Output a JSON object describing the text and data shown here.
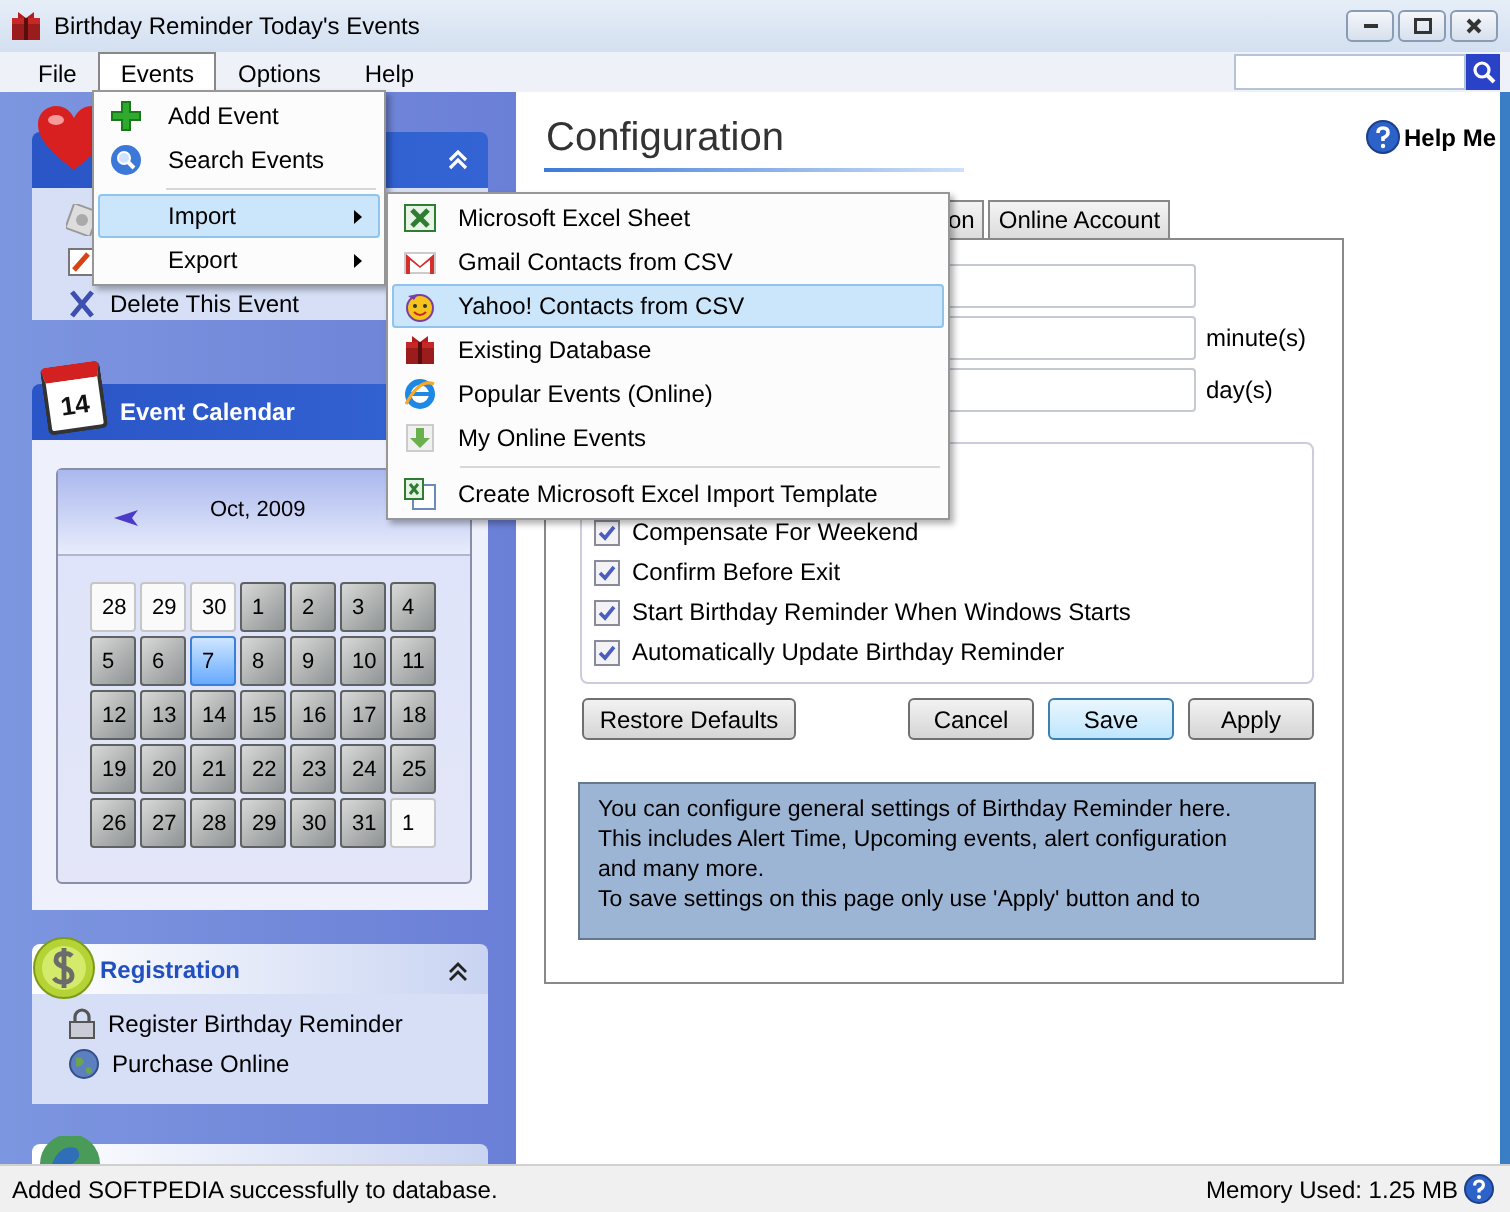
{
  "window": {
    "title": "Birthday Reminder Today's Events"
  },
  "menu_bar": [
    {
      "label": "File",
      "selected": false
    },
    {
      "label": "Events",
      "selected": true
    },
    {
      "label": "Options",
      "selected": false
    },
    {
      "label": "Help",
      "selected": false
    }
  ],
  "events_menu": [
    {
      "kind": "item",
      "label": "Add Event",
      "selected": false
    },
    {
      "kind": "item",
      "label": "Search Events",
      "selected": false
    },
    {
      "kind": "separator"
    },
    {
      "kind": "submenu",
      "label": "Import",
      "selected": true
    },
    {
      "kind": "submenu",
      "label": "Export",
      "selected": false
    }
  ],
  "import_submenu": [
    {
      "kind": "item",
      "label": "Microsoft Excel Sheet",
      "selected": false
    },
    {
      "kind": "item",
      "label": "Gmail Contacts from CSV",
      "selected": false
    },
    {
      "kind": "item",
      "label": "Yahoo! Contacts from CSV",
      "selected": true
    },
    {
      "kind": "item",
      "label": "Existing Database",
      "selected": false
    },
    {
      "kind": "item",
      "label": "Popular Events (Online)",
      "selected": false
    },
    {
      "kind": "item",
      "label": "My Online Events",
      "selected": false
    },
    {
      "kind": "separator"
    },
    {
      "kind": "item",
      "label": "Create Microsoft Excel Import Template",
      "selected": false
    }
  ],
  "event_panel": {
    "items": [
      {
        "label": "Delete This Event"
      }
    ]
  },
  "calendar_panel": {
    "title": "Event Calendar",
    "icon_day": "14",
    "month": "Oct, 2009",
    "days": [
      {
        "day": "28",
        "kind": "other",
        "selected": false
      },
      {
        "day": "29",
        "kind": "other",
        "selected": false
      },
      {
        "day": "30",
        "kind": "other",
        "selected": false
      },
      {
        "day": "1",
        "kind": "current",
        "selected": false
      },
      {
        "day": "2",
        "kind": "current",
        "selected": false
      },
      {
        "day": "3",
        "kind": "current",
        "selected": false
      },
      {
        "day": "4",
        "kind": "current",
        "selected": false
      },
      {
        "day": "5",
        "kind": "current",
        "selected": false
      },
      {
        "day": "6",
        "kind": "current",
        "selected": false
      },
      {
        "day": "7",
        "kind": "current",
        "selected": true
      },
      {
        "day": "8",
        "kind": "current",
        "selected": false
      },
      {
        "day": "9",
        "kind": "current",
        "selected": false
      },
      {
        "day": "10",
        "kind": "current",
        "selected": false
      },
      {
        "day": "11",
        "kind": "current",
        "selected": false
      },
      {
        "day": "12",
        "kind": "current",
        "selected": false
      },
      {
        "day": "13",
        "kind": "current",
        "selected": false
      },
      {
        "day": "14",
        "kind": "current",
        "selected": false
      },
      {
        "day": "15",
        "kind": "current",
        "selected": false
      },
      {
        "day": "16",
        "kind": "current",
        "selected": false
      },
      {
        "day": "17",
        "kind": "current",
        "selected": false
      },
      {
        "day": "18",
        "kind": "current",
        "selected": false
      },
      {
        "day": "19",
        "kind": "current",
        "selected": false
      },
      {
        "day": "20",
        "kind": "current",
        "selected": false
      },
      {
        "day": "21",
        "kind": "current",
        "selected": false
      },
      {
        "day": "22",
        "kind": "current",
        "selected": false
      },
      {
        "day": "23",
        "kind": "current",
        "selected": false
      },
      {
        "day": "24",
        "kind": "current",
        "selected": false
      },
      {
        "day": "25",
        "kind": "current",
        "selected": false
      },
      {
        "day": "26",
        "kind": "current",
        "selected": false
      },
      {
        "day": "27",
        "kind": "current",
        "selected": false
      },
      {
        "day": "28",
        "kind": "current",
        "selected": false
      },
      {
        "day": "29",
        "kind": "current",
        "selected": false
      },
      {
        "day": "30",
        "kind": "current",
        "selected": false
      },
      {
        "day": "31",
        "kind": "current",
        "selected": false
      },
      {
        "day": "1",
        "kind": "other",
        "selected": false
      }
    ]
  },
  "registration_panel": {
    "title": "Registration",
    "items": [
      {
        "label": "Register Birthday Reminder"
      },
      {
        "label": "Purchase Online"
      }
    ]
  },
  "configuration": {
    "title": "Configuration",
    "help": "Help Me",
    "tabs": [
      {
        "label": "on",
        "selected": false
      },
      {
        "label": "Online Account",
        "selected": false
      }
    ],
    "fields": [
      {
        "kind": "plain"
      },
      {
        "kind": "unit",
        "unit": "minute(s)"
      },
      {
        "kind": "unit",
        "unit": "day(s)"
      }
    ],
    "options": [
      {
        "label": "Compensate For Weekend",
        "checked": true
      },
      {
        "label": "Confirm Before Exit",
        "checked": true
      },
      {
        "label": "Start Birthday Reminder When Windows Starts",
        "checked": true
      },
      {
        "label": "Automatically Update Birthday Reminder",
        "checked": true
      }
    ],
    "buttons": [
      {
        "label": "Restore Defaults",
        "focused": false
      },
      {
        "label": "Cancel",
        "focused": false
      },
      {
        "label": "Save",
        "focused": true
      },
      {
        "label": "Apply",
        "focused": false
      }
    ],
    "info": "You can configure general settings of Birthday Reminder here.\nThis includes Alert Time, Upcoming events, alert configuration\nand many more.\nTo save settings on this page only use 'Apply' button and to"
  },
  "status_bar": {
    "message": "Added SOFTPEDIA successfully to database.",
    "memory": "Memory Used: 1.25 MB"
  }
}
